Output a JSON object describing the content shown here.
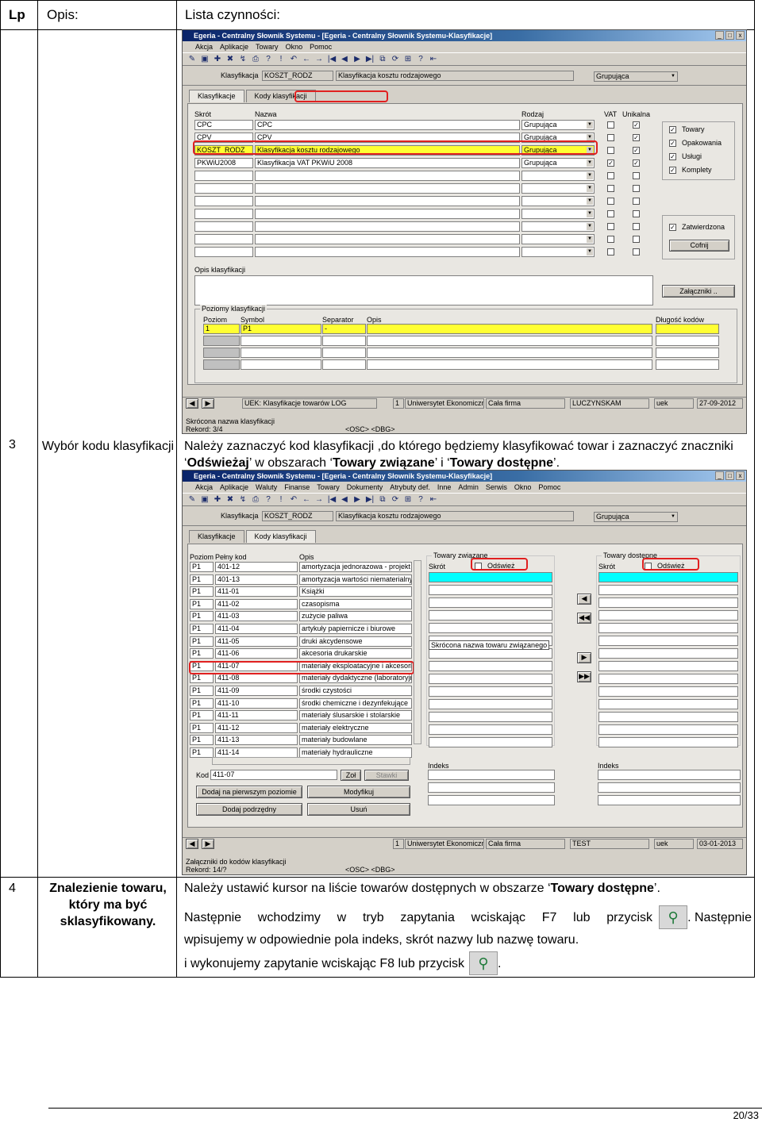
{
  "table": {
    "headers": {
      "lp": "Lp",
      "opis": "Opis:",
      "lista": "Lista czynności:"
    },
    "rows": [
      {
        "lp": "3",
        "title": "Wybór kodu klasyfikacji",
        "text_parts": [
          "Należy zaznaczyć kod klasyfikacji ,do którego będziemy klasyfikować towar i zaznaczyć znaczniki ‘",
          "Odświeżaj",
          "’ w obszarach ‘",
          "Towary związane",
          "’ i ‘",
          "Towary dostępne",
          "’."
        ]
      },
      {
        "lp": "4",
        "title": "Znalezienie towaru, który ma być sklasyfikowany.",
        "line1_parts": [
          "Należy ustawić kursor na liście towarów dostępnych w obszarze ‘",
          "Towary dostępne",
          "’."
        ],
        "line2a": "Następnie wchodzimy w tryb zapytania wciskając F7 lub przycisk",
        "line2b": ". Następnie",
        "line3": "wpisujemy w odpowiednie pola indeks, skrót nazwy  lub nazwę towaru.",
        "line4": "i wykonujemy zapytanie wciskając F8 lub przycisk",
        "line4_end": "."
      }
    ]
  },
  "screen1": {
    "title": "Egeria - Centralny Słownik Systemu - [Egeria - Centralny Słownik Systemu-Klasyfikacje]",
    "menu": [
      "Akcja",
      "Aplikacje",
      "Towary",
      "Okno",
      "Pomoc"
    ],
    "top": {
      "label": "Klasyfikacja",
      "code": "KOSZT_RODZ",
      "name": "Klasyfikacja kosztu rodzajowego",
      "type": "Grupująca"
    },
    "tabs": [
      "Klasyfikacje",
      "Kody klasyfikacji"
    ],
    "cols": [
      "Skrót",
      "Nazwa",
      "Rodzaj",
      "VAT",
      "Unikalna"
    ],
    "rows": [
      {
        "skrot": "CPC",
        "nazwa": "CPC",
        "rodzaj": "Grupująca",
        "vat": "",
        "uni": "✓"
      },
      {
        "skrot": "CPV",
        "nazwa": "CPV",
        "rodzaj": "Grupująca",
        "vat": "",
        "uni": "✓"
      },
      {
        "skrot": "KOSZT_RODZ",
        "nazwa": "Klasyfikacja kosztu rodzajowego",
        "rodzaj": "Grupująca",
        "vat": "",
        "uni": "✓"
      },
      {
        "skrot": "PKWiU2008",
        "nazwa": "Klasyfikacja VAT PKWiU 2008",
        "rodzaj": "Grupująca",
        "vat": "✓",
        "uni": "✓"
      }
    ],
    "side_checks": [
      "Towary",
      "Opakowania",
      "Usługi",
      "Komplety"
    ],
    "zatw": "Zatwierdzona",
    "cofnij": "Cofnij",
    "opis_label": "Opis klasyfikacji",
    "zalaczniki": "Załączniki ..",
    "poziomy": {
      "title": "Poziomy klasyfikacji",
      "cols": [
        "Poziom",
        "Symbol",
        "Separator",
        "Opis"
      ],
      "dlug": "Długość kodów",
      "row": {
        "poziom": "1",
        "symbol": "P1",
        "sep": "-"
      }
    },
    "status": [
      "UEK: Klasyfikacje towarów LOG",
      "1",
      "Uniwersytet Ekonomiczny",
      "Cała firma",
      "LUCZYNSKAM",
      "uek",
      "27-09-2012"
    ],
    "skrocona": "Skrócona nazwa klasyfikacji",
    "rekord": "Rekord: 3/4",
    "osc": "<OSC> <DBG>"
  },
  "screen2": {
    "title": "Egeria - Centralny Słownik Systemu - [Egeria - Centralny Słownik Systemu-Klasyfikacje]",
    "menu": [
      "Akcja",
      "Aplikacje",
      "Waluty",
      "Finanse",
      "Towary",
      "Dokumenty",
      "Atrybuty def.",
      "Inne",
      "Admin",
      "Serwis",
      "Okno",
      "Pomoc"
    ],
    "top": {
      "label": "Klasyfikacja",
      "code": "KOSZT_RODZ",
      "name": "Klasyfikacja kosztu rodzajowego",
      "type": "Grupująca"
    },
    "tabs": [
      "Klasyfikacje",
      "Kody klasyfikacji"
    ],
    "cols": [
      "Poziom",
      "Pełny kod",
      "Opis"
    ],
    "rows": [
      {
        "p": "P1",
        "kod": "401-12",
        "opis": "amortyzacja jednorazowa - projekt"
      },
      {
        "p": "P1",
        "kod": "401-13",
        "opis": "amortyzacja wartości niematerialnych"
      },
      {
        "p": "P1",
        "kod": "411-01",
        "opis": "Książki"
      },
      {
        "p": "P1",
        "kod": "411-02",
        "opis": "czasopisma"
      },
      {
        "p": "P1",
        "kod": "411-03",
        "opis": "zużycie paliwa"
      },
      {
        "p": "P1",
        "kod": "411-04",
        "opis": "artykuły papiernicze i biurowe"
      },
      {
        "p": "P1",
        "kod": "411-05",
        "opis": "druki akcydensowe"
      },
      {
        "p": "P1",
        "kod": "411-06",
        "opis": "akcesoria drukarskie"
      },
      {
        "p": "P1",
        "kod": "411-07",
        "opis": "materiały eksploatacyjne i akcesoria"
      },
      {
        "p": "P1",
        "kod": "411-08",
        "opis": "materiały dydaktyczne (laboratoryjne)"
      },
      {
        "p": "P1",
        "kod": "411-09",
        "opis": "środki czystości"
      },
      {
        "p": "P1",
        "kod": "411-10",
        "opis": "środki chemiczne i dezynfekujące"
      },
      {
        "p": "P1",
        "kod": "411-11",
        "opis": "materiały ślusarskie i stolarskie"
      },
      {
        "p": "P1",
        "kod": "411-12",
        "opis": "materiały elektryczne"
      },
      {
        "p": "P1",
        "kod": "411-13",
        "opis": "materiały budowlane"
      },
      {
        "p": "P1",
        "kod": "411-14",
        "opis": "materiały hydrauliczne"
      }
    ],
    "tz": {
      "title": "Towary związane",
      "skrot": "Skrót",
      "odswiezaj": "Odśwież",
      "tooltip": "Skrócona nazwa towaru związanego",
      "indeks": "Indeks"
    },
    "td": {
      "title": "Towary dostępne",
      "skrot": "Skrót",
      "odswiezaj": "Odśwież",
      "indeks": "Indeks"
    },
    "kod_label": "Kod",
    "kod_value": "411-07",
    "zol": "Zoł",
    "stawki": "Stawki",
    "buttons": [
      "Dodaj na pierwszym poziomie",
      "Modyfikuj",
      "Dodaj podrzędny",
      "Usuń"
    ],
    "status": [
      "",
      "1",
      "Uniwersytet Ekonomiczny",
      "Cała firma",
      "TEST",
      "uek",
      "03-01-2013"
    ],
    "zalaczniki": "Załączniki do kodów klasyfikacji",
    "rekord": "Rekord: 14/?",
    "osc": "<OSC> <DBG>"
  },
  "icons": {
    "query_enter": "query-mode-icon",
    "query_execute": "query-execute-icon"
  },
  "page_number": "20/33"
}
